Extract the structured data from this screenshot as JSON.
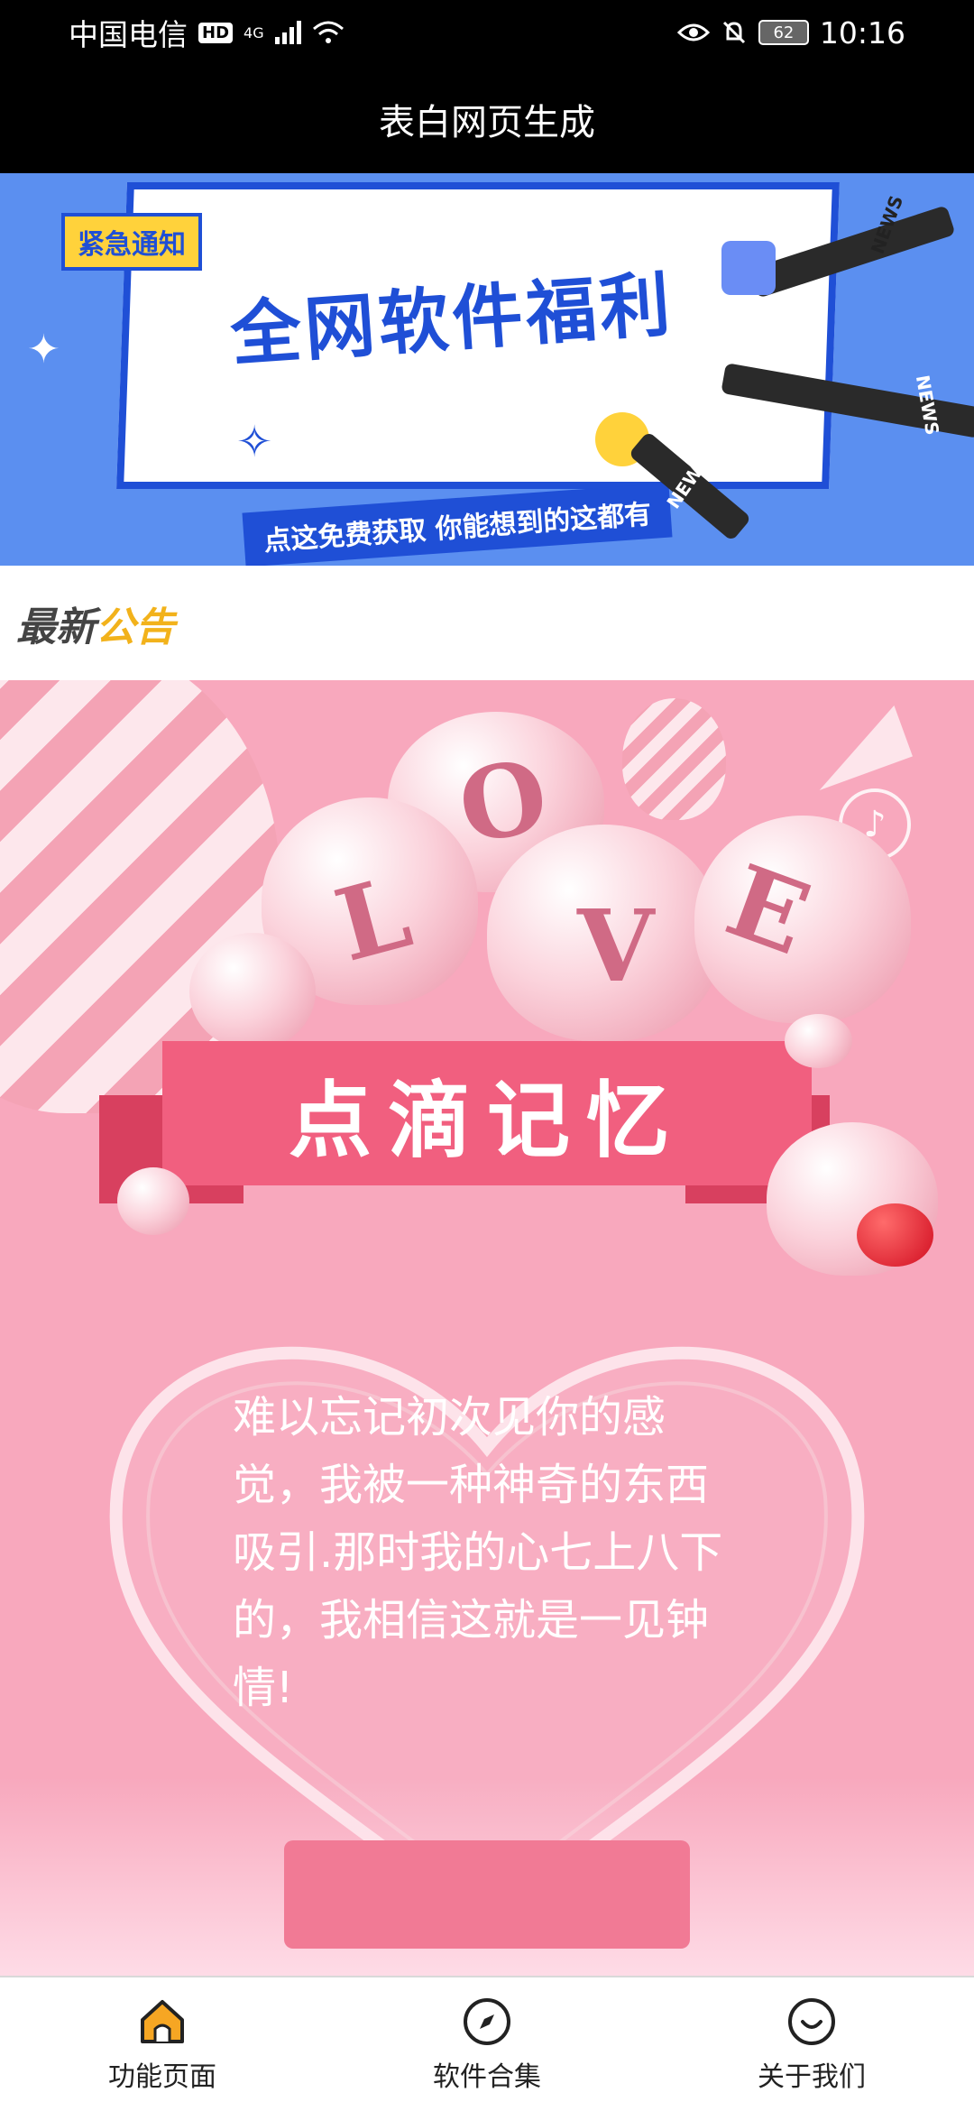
{
  "status_bar": {
    "carrier": "中国电信",
    "hd": "HD",
    "network": "4G",
    "battery": "62",
    "time": "10:16"
  },
  "app": {
    "title": "表白网页生成"
  },
  "banner": {
    "tag": "紧急通知",
    "headline": "全网软件福利",
    "subline": "点这免费获取 你能想到的这都有",
    "mic_labels": [
      "NEWS",
      "NEWS",
      "NEWS"
    ]
  },
  "announcement": {
    "part1": "最新",
    "part2": "公告"
  },
  "love_card": {
    "letters": [
      "L",
      "O",
      "V",
      "E"
    ],
    "ribbon_title": "点滴记忆",
    "message": "难以忘记初次见你的感觉，我被一种神奇的东西吸引.那时我的心七上八下的，我相信这就是一见钟情!",
    "music_icon": "music-note-icon"
  },
  "bottom_nav": {
    "items": [
      {
        "label": "功能页面",
        "icon": "home-icon",
        "active": true
      },
      {
        "label": "软件合集",
        "icon": "compass-icon",
        "active": false
      },
      {
        "label": "关于我们",
        "icon": "smile-icon",
        "active": false
      }
    ]
  },
  "colors": {
    "banner_bg": "#5b8ff0",
    "banner_accent": "#1f4fd6",
    "love_bg": "#f8a8bd",
    "ribbon": "#f15f7f",
    "home_icon_fill": "#f6a623"
  }
}
